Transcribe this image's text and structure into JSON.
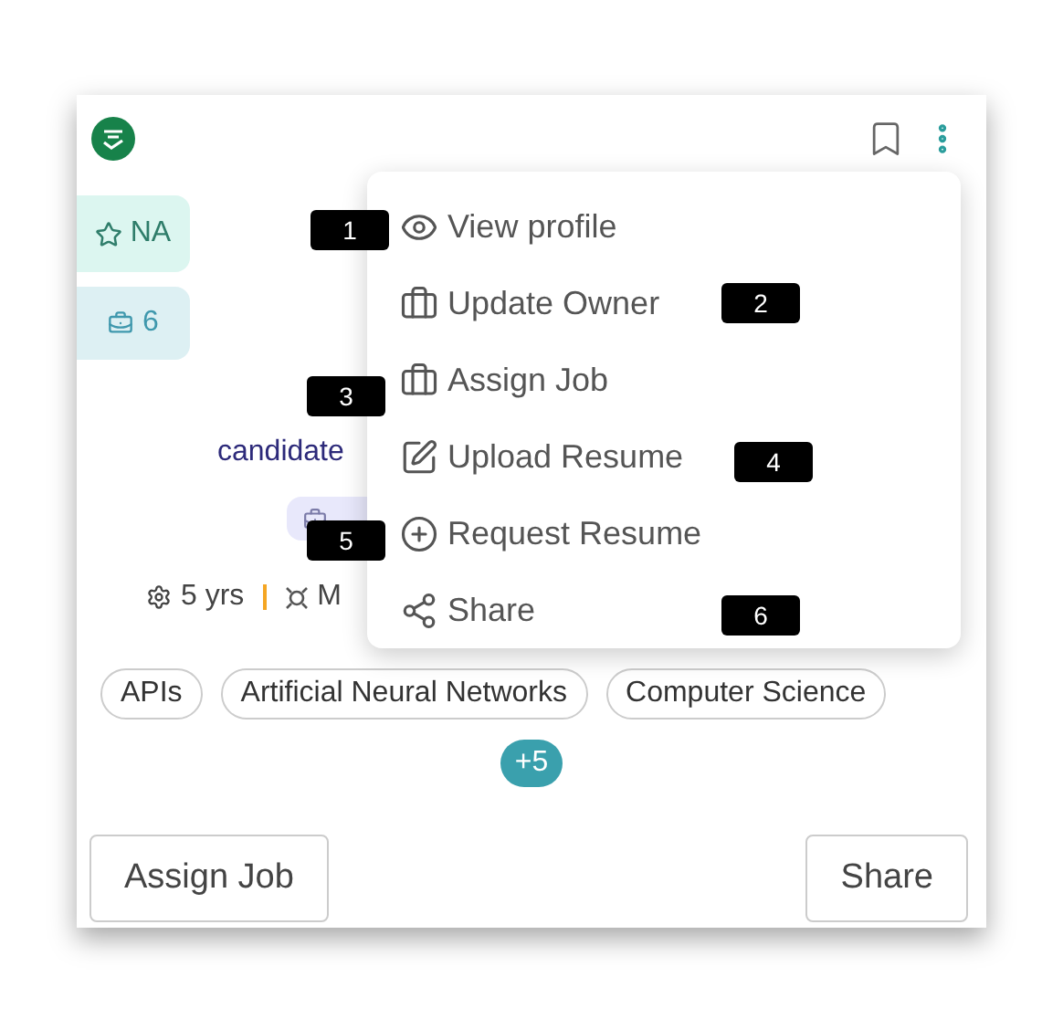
{
  "card": {
    "rating": "NA",
    "jobs": "6",
    "email": "candidate",
    "experience": "5 yrs",
    "location": "M",
    "skills": [
      "APIs",
      "Artificial Neural Networks",
      "Computer Science"
    ],
    "more_skills": "+5",
    "buttons": [
      "Assign Job",
      "Share"
    ]
  },
  "menu": {
    "items": [
      {
        "label": "View profile"
      },
      {
        "label": "Update Owner"
      },
      {
        "label": "Assign Job"
      },
      {
        "label": "Upload Resume"
      },
      {
        "label": "Request Resume"
      },
      {
        "label": "Share"
      }
    ]
  },
  "callouts": [
    "1",
    "2",
    "3",
    "4",
    "5",
    "6"
  ]
}
